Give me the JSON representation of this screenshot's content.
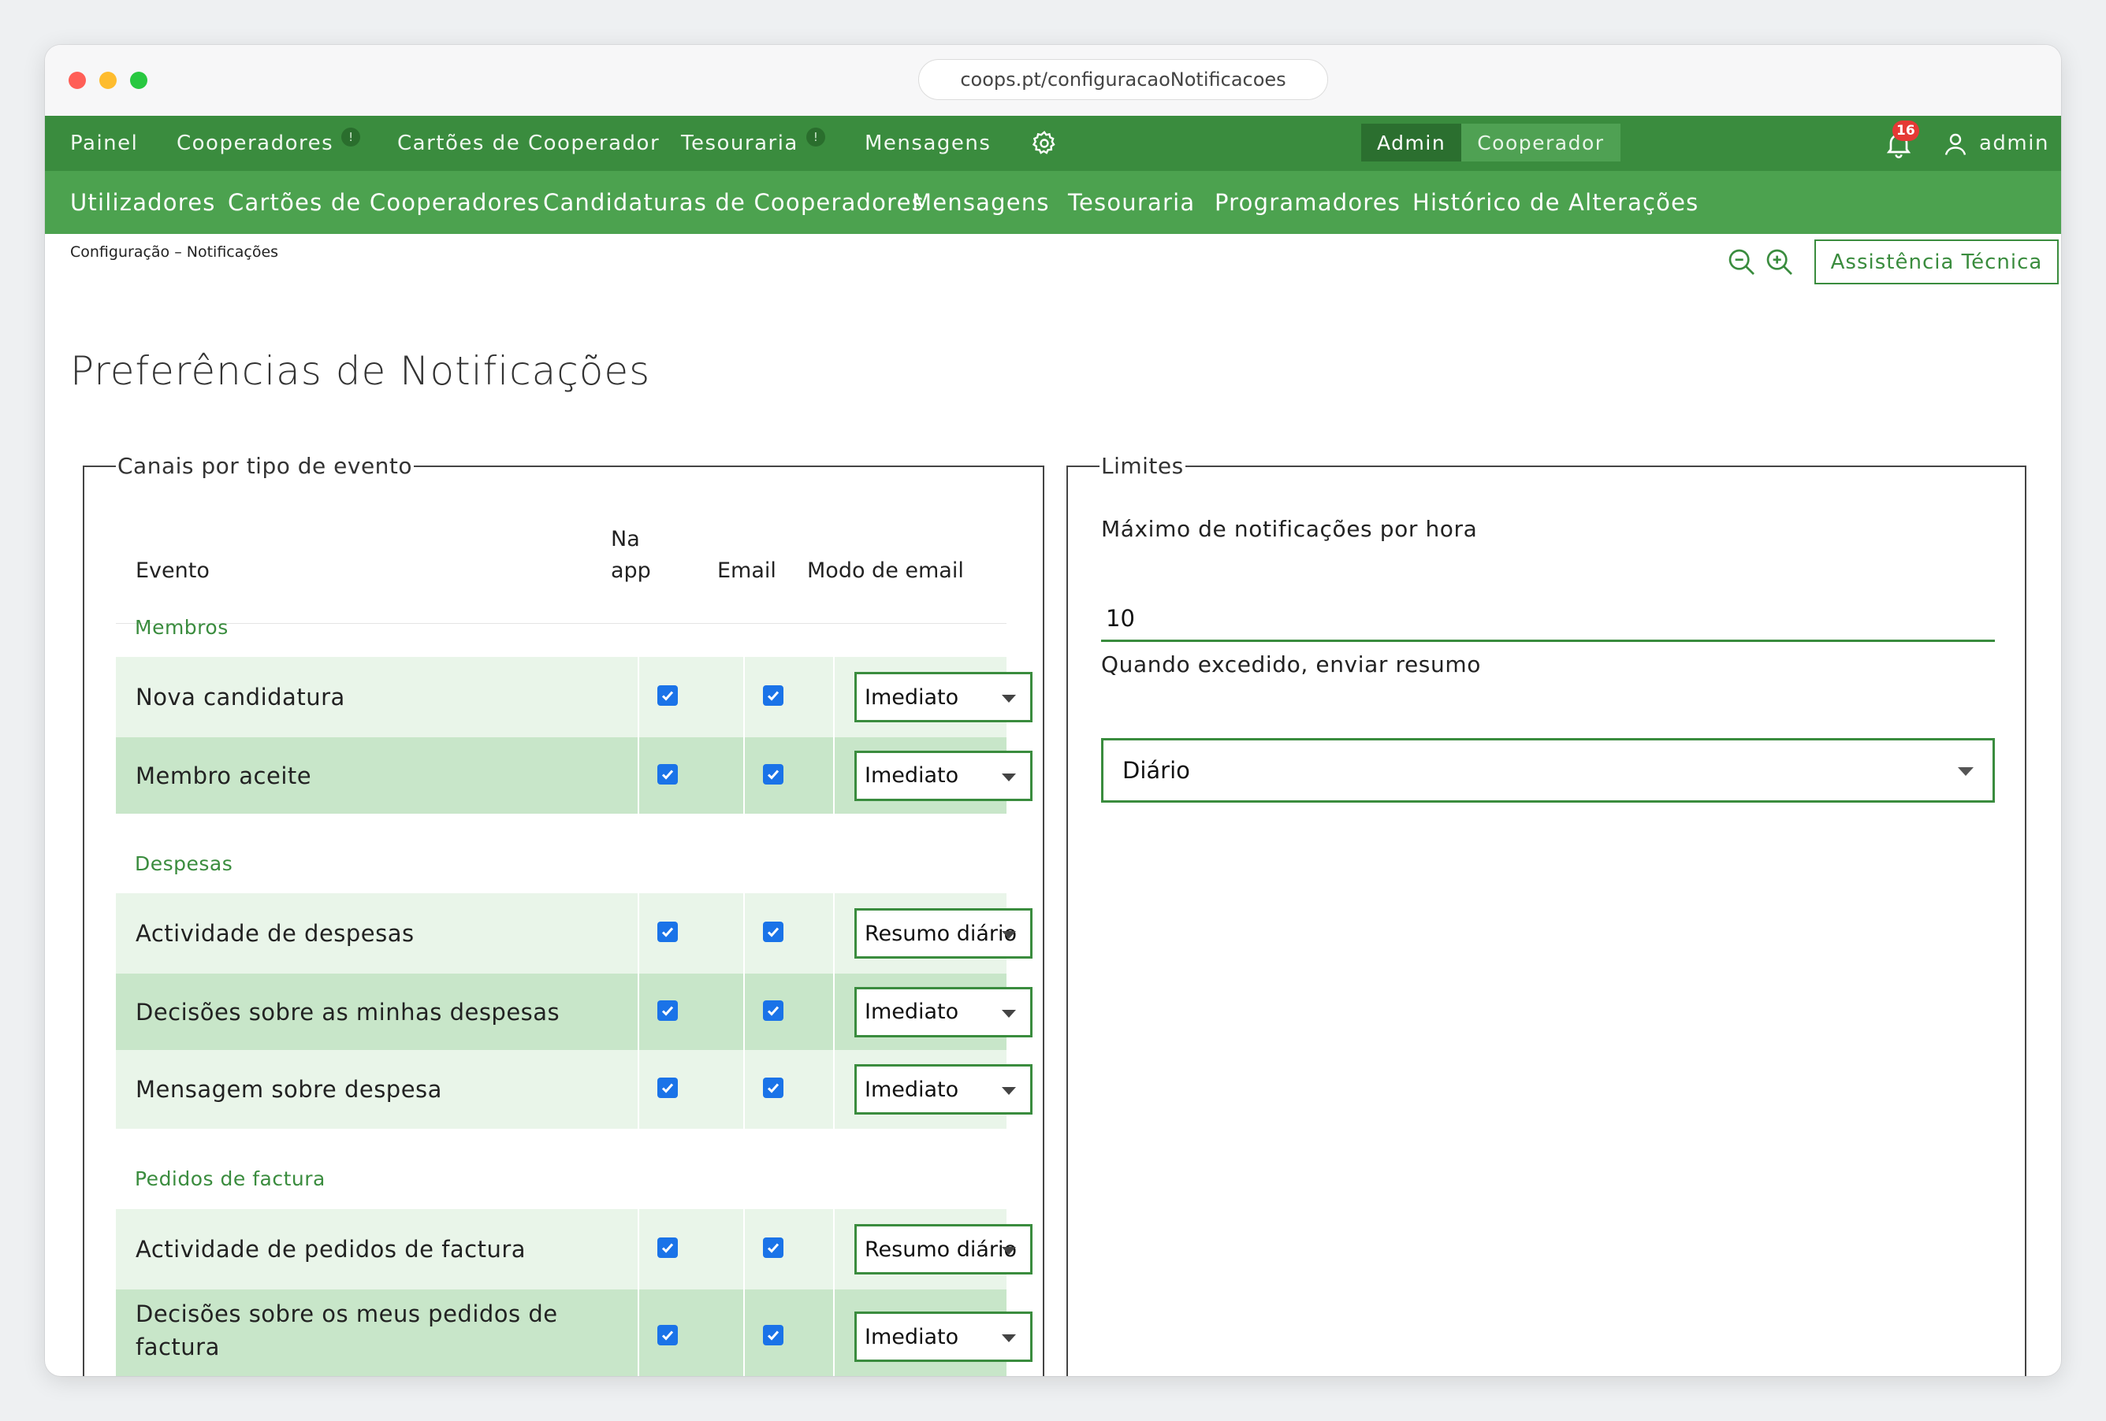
{
  "browser": {
    "url": "coops.pt/configuracaoNotificacoes"
  },
  "topnav": {
    "items": [
      {
        "label": "Painel",
        "badge": ""
      },
      {
        "label": "Cooperadores",
        "badge": "!"
      },
      {
        "label": "Cartões de Cooperador",
        "badge": ""
      },
      {
        "label": "Tesouraria",
        "badge": "!"
      },
      {
        "label": "Mensagens",
        "badge": ""
      }
    ],
    "roles": {
      "admin": "Admin",
      "cooperador": "Cooperador"
    },
    "notifications_count": "16",
    "user_name": "admin"
  },
  "subnav": {
    "items": [
      "Utilizadores",
      "Cartões de Cooperadores",
      "Candidaturas de Cooperadores",
      "Mensagens",
      "Tesouraria",
      "Programadores",
      "Histórico de Alterações"
    ]
  },
  "breadcrumb": "Configuração – Notificações",
  "assist_button": "Assistência Técnica",
  "page_title": "Preferências de Notificações",
  "channels": {
    "legend": "Canais por tipo de evento",
    "headers": {
      "event": "Evento",
      "in_app": "Na\napp",
      "email": "Email",
      "email_mode": "Modo de email"
    },
    "groups": [
      {
        "title": "Membros",
        "rows": [
          {
            "event": "Nova candidatura",
            "in_app": true,
            "email": true,
            "mode": "Imediato"
          },
          {
            "event": "Membro aceite",
            "in_app": true,
            "email": true,
            "mode": "Imediato"
          }
        ]
      },
      {
        "title": "Despesas",
        "rows": [
          {
            "event": "Actividade de despesas",
            "in_app": true,
            "email": true,
            "mode": "Resumo diário"
          },
          {
            "event": "Decisões sobre as minhas despesas",
            "in_app": true,
            "email": true,
            "mode": "Imediato"
          },
          {
            "event": "Mensagem sobre despesa",
            "in_app": true,
            "email": true,
            "mode": "Imediato"
          }
        ]
      },
      {
        "title": "Pedidos de factura",
        "rows": [
          {
            "event": "Actividade de pedidos de factura",
            "in_app": true,
            "email": true,
            "mode": "Resumo diário"
          },
          {
            "event": "Decisões sobre os meus pedidos de factura",
            "in_app": true,
            "email": true,
            "mode": "Imediato"
          }
        ]
      }
    ]
  },
  "limits": {
    "legend": "Limites",
    "max_label": "Máximo de notificações por hora",
    "max_value": "10",
    "digest_label": "Quando excedido, enviar resumo",
    "digest_value": "Diário"
  },
  "colors": {
    "primary": "#3a8c3e",
    "subnav": "#4ca24f",
    "row_light": "#e9f5e9",
    "row_dark": "#c8e6c9",
    "checkbox": "#1a73e8",
    "badge": "#e53935"
  }
}
